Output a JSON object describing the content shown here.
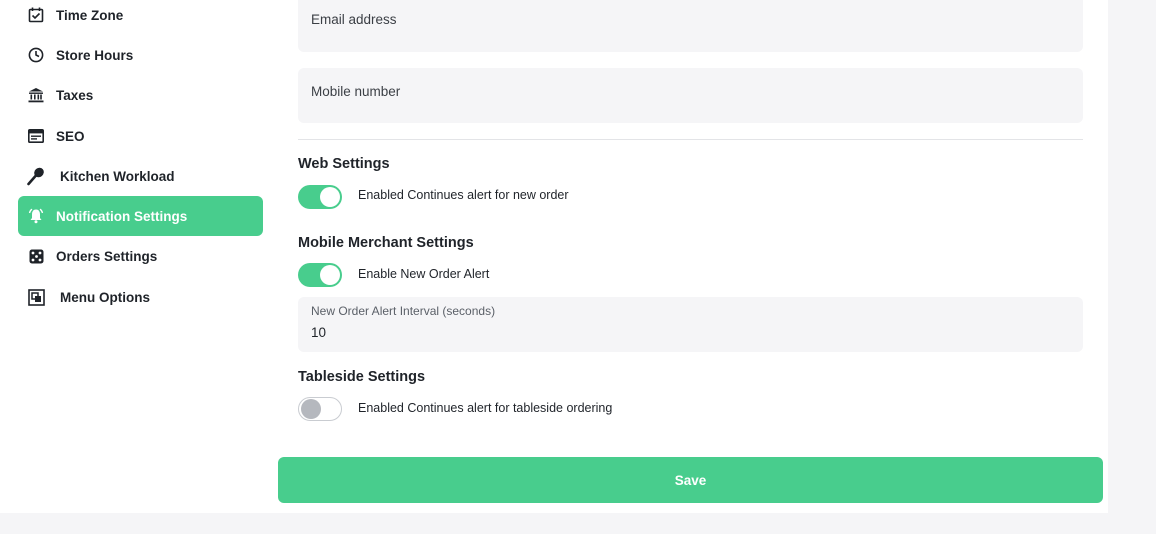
{
  "sidebar": {
    "items": [
      {
        "label": "Time Zone",
        "icon": "calendar-check-icon"
      },
      {
        "label": "Store Hours",
        "icon": "clock-icon"
      },
      {
        "label": "Taxes",
        "icon": "bank-icon"
      },
      {
        "label": "SEO",
        "icon": "browser-window-icon"
      },
      {
        "label": "Kitchen Workload",
        "icon": "kitchen-utensil-icon"
      },
      {
        "label": "Notification Settings",
        "icon": "bell-icon",
        "active": true
      },
      {
        "label": "Orders Settings",
        "icon": "dice-icon"
      },
      {
        "label": "Menu Options",
        "icon": "menu-frame-icon"
      }
    ]
  },
  "form": {
    "email_placeholder": "Email address",
    "mobile_placeholder": "Mobile number"
  },
  "web_settings": {
    "title": "Web Settings",
    "toggle_label": "Enabled Continues alert for new order",
    "enabled": true
  },
  "mobile_settings": {
    "title": "Mobile Merchant Settings",
    "toggle_label": "Enable New Order Alert",
    "enabled": true,
    "interval_label": "New Order Alert Interval (seconds)",
    "interval_value": "10"
  },
  "tableside_settings": {
    "title": "Tableside Settings",
    "toggle_label": "Enabled Continues alert for tableside ordering",
    "enabled": false
  },
  "save_label": "Save",
  "colors": {
    "accent": "#48cd8d",
    "field_bg": "#f5f5f7",
    "page_bg": "#f5f5f7"
  }
}
